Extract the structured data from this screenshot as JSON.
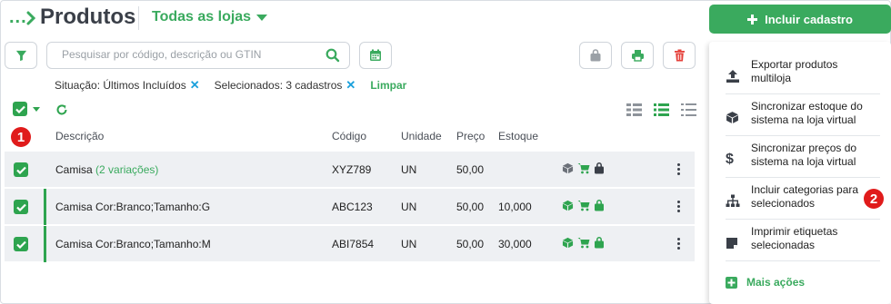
{
  "header": {
    "breadcrumb_ellipsis": "...",
    "title": "Produtos",
    "store_select": "Todas as lojas"
  },
  "search": {
    "placeholder": "Pesquisar por código, descrição ou GTIN"
  },
  "filters": {
    "situation": "Situação: Últimos Incluídos",
    "selected": "Selecionados: 3 cadastros",
    "clear": "Limpar"
  },
  "table": {
    "columns": [
      "Descrição",
      "Código",
      "Unidade",
      "Preço",
      "Estoque"
    ],
    "rows": [
      {
        "description": "Camisa",
        "variations": "(2 variações)",
        "code": "XYZ789",
        "unit": "UN",
        "price": "50,00",
        "stock": ""
      },
      {
        "description": "Camisa Cor:Branco;Tamanho:G",
        "variations": "",
        "code": "ABC123",
        "unit": "UN",
        "price": "50,00",
        "stock": "10,000"
      },
      {
        "description": "Camisa Cor:Branco;Tamanho:M",
        "variations": "",
        "code": "ABI7854",
        "unit": "UN",
        "price": "50,00",
        "stock": "30,000"
      }
    ]
  },
  "actions": {
    "include_button": "Incluir cadastro",
    "menu": [
      {
        "icon": "upload-icon",
        "label": "Exportar produtos multiloja"
      },
      {
        "icon": "box-icon",
        "label": "Sincronizar estoque do sistema na loja virtual"
      },
      {
        "icon": "dollar-icon",
        "label": "Sincronizar preços do sistema na loja virtual"
      },
      {
        "icon": "sitemap-icon",
        "label": "Incluir categorias para selecionados"
      },
      {
        "icon": "label-icon",
        "label": "Imprimir etiquetas selecionadas"
      }
    ],
    "more": "Mais ações"
  },
  "annotations": {
    "badge1": "1",
    "badge2": "2"
  },
  "colors": {
    "accent": "#3aaa5e",
    "danger": "#e5403a",
    "link": "#1aa0dc",
    "badge": "#e01b1b"
  }
}
